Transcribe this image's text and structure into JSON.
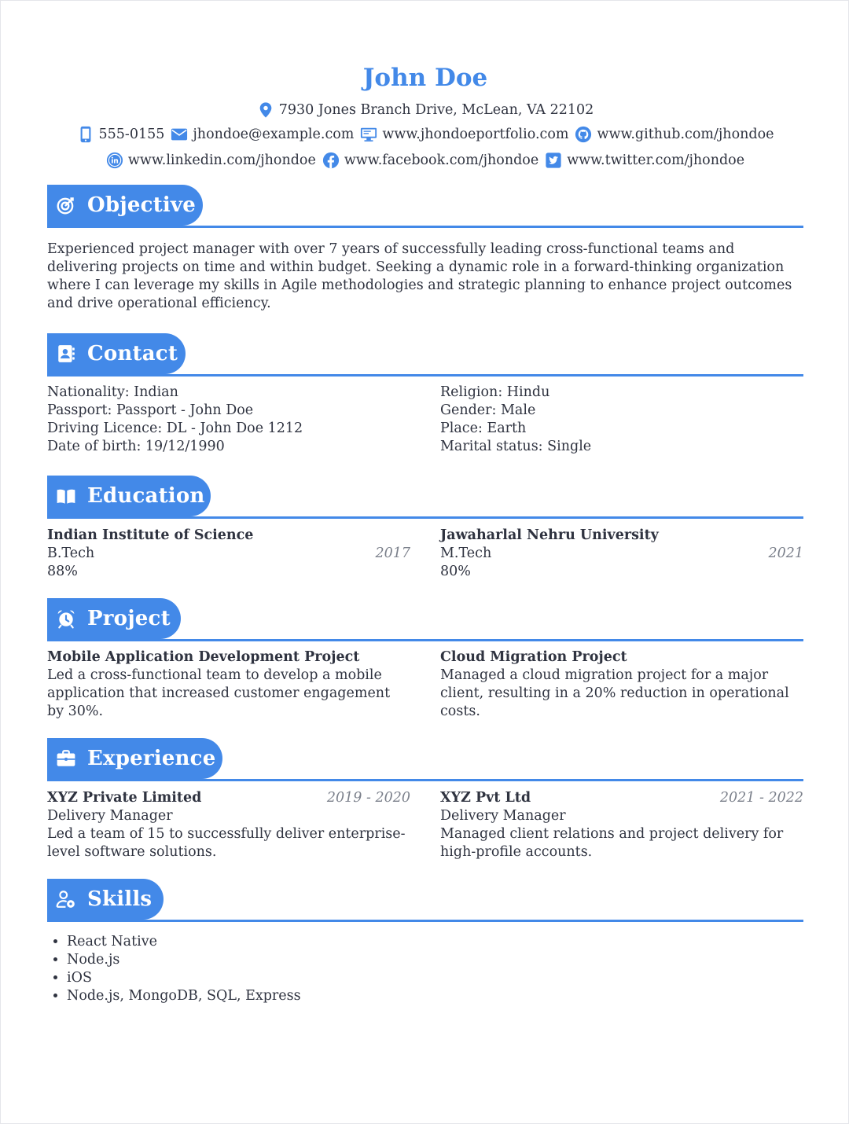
{
  "header": {
    "name": "John Doe",
    "address": "7930 Jones Branch Drive, McLean, VA 22102",
    "phone": "555-0155",
    "email": "jhondoe@example.com",
    "portfolio": "www.jhondoeportfolio.com",
    "github": "www.github.com/jhondoe",
    "linkedin": "www.linkedin.com/jhondoe",
    "facebook": "www.facebook.com/jhondoe",
    "twitter": "www.twitter.com/jhondoe"
  },
  "accent_color": "#4389e8",
  "objective": {
    "title": "Objective",
    "icon": "target-icon",
    "text": "Experienced project manager with over 7 years of successfully leading cross-functional teams and delivering projects on time and within budget. Seeking a dynamic role in a forward-thinking organization where I can leverage my skills in Agile methodologies and strategic planning to enhance project outcomes and drive operational efficiency."
  },
  "contact": {
    "title": "Contact",
    "icon": "address-book-icon",
    "left": [
      "Nationality: Indian",
      "Passport: Passport - John Doe",
      "Driving Licence: DL - John Doe 1212",
      "Date of birth: 19/12/1990"
    ],
    "right": [
      "Religion: Hindu",
      "Gender: Male",
      "Place: Earth",
      "Marital status: Single"
    ]
  },
  "education": {
    "title": "Education",
    "icon": "book-icon",
    "items": [
      {
        "institution": "Indian Institute of Science",
        "degree": "B.Tech",
        "year": "2017",
        "score": "88%"
      },
      {
        "institution": "Jawaharlal Nehru University",
        "degree": "M.Tech",
        "year": "2021",
        "score": "80%"
      }
    ]
  },
  "project": {
    "title": "Project",
    "icon": "alarm-clock-icon",
    "items": [
      {
        "name": "Mobile Application Development Project",
        "description": "Led a cross-functional team to develop a mobile application that increased customer engagement by 30%."
      },
      {
        "name": "Cloud Migration Project",
        "description": "Managed a cloud migration project for a major client, resulting in a 20% reduction in operational costs."
      }
    ]
  },
  "experience": {
    "title": "Experience",
    "icon": "briefcase-icon",
    "items": [
      {
        "company": "XYZ Private Limited",
        "dates": "2019 - 2020",
        "role": "Delivery Manager",
        "description": "Led a team of 15 to successfully deliver enterprise-level software solutions."
      },
      {
        "company": "XYZ Pvt Ltd",
        "dates": "2021 - 2022",
        "role": "Delivery Manager",
        "description": "Managed client relations and project delivery for high-profile accounts."
      }
    ]
  },
  "skills": {
    "title": "Skills",
    "icon": "user-cog-icon",
    "items": [
      "React Native",
      "Node.js",
      "iOS",
      "Node.js, MongoDB, SQL, Express"
    ]
  }
}
